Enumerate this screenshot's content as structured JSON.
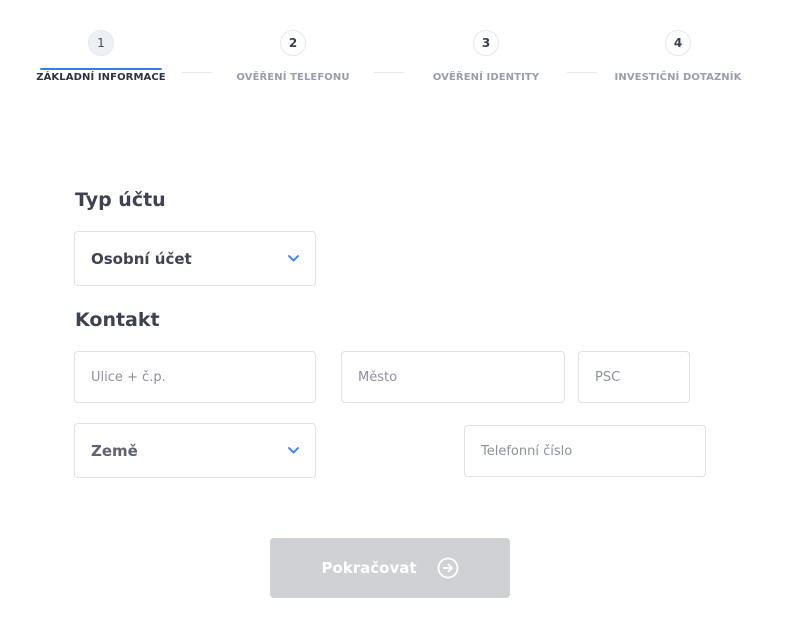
{
  "stepper": {
    "steps": [
      {
        "number": "1",
        "label": "ZÁKLADNÍ INFORMACE",
        "state": "active"
      },
      {
        "number": "2",
        "label": "OVĚŘENÍ TELEFONU",
        "state": "pending"
      },
      {
        "number": "3",
        "label": "OVĚŘENÍ IDENTITY",
        "state": "pending"
      },
      {
        "number": "4",
        "label": "INVESTIČNÍ DOTAZNÍK",
        "state": "pending"
      }
    ],
    "accent_color": "#2f80ed"
  },
  "account_type": {
    "heading": "Typ účtu",
    "selected": "Osobní účet"
  },
  "contact": {
    "heading": "Kontakt",
    "street_placeholder": "Ulice + č.p.",
    "city_placeholder": "Město",
    "zip_placeholder": "PSČ",
    "country_selected": "Země",
    "phone_placeholder": "Telefonní číslo"
  },
  "actions": {
    "continue_label": "Pokračovat",
    "continue_icon": "arrow-right-circle-icon"
  }
}
